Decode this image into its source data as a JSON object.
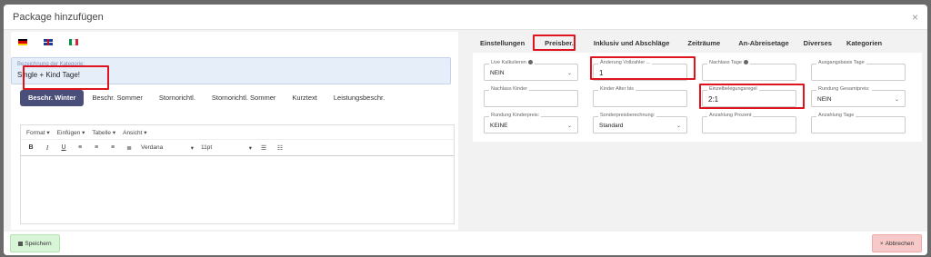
{
  "modal": {
    "title": "Package hinzufügen"
  },
  "kategorie": {
    "label": "Bezeichnung der Kategorie:",
    "value": "Single + Kind Tage!"
  },
  "desc_tabs": [
    "Beschr. Winter",
    "Beschr. Sommer",
    "Stornorichtl.",
    "Stornorichtl. Sommer",
    "Kurztext",
    "Leistungsbeschr."
  ],
  "editor": {
    "menu": [
      "Format",
      "Einfügen",
      "Tabelle",
      "Ansicht"
    ],
    "font": "Verdana",
    "size": "11pt"
  },
  "right_tabs": [
    "Einstellungen",
    "Preisber.",
    "Inklusiv und Abschläge",
    "Zeiträume",
    "An-Abreisetage",
    "Diverses",
    "Kategorien"
  ],
  "fields": {
    "live_kalk": {
      "label": "Live Kalkulieren",
      "value": "NEIN"
    },
    "anderung_vollzahler": {
      "label": "Änderung Vollzahler ...",
      "value": "1"
    },
    "nachlass_tage": {
      "label": "Nachlass Tage",
      "value": ""
    },
    "ausgangsbasis_tage": {
      "label": "Ausgangsbasis Tage",
      "value": ""
    },
    "nachlass_kinder": {
      "label": "Nachlass Kinder",
      "value": ""
    },
    "kinder_alter_bis": {
      "label": "Kinder Alter bis",
      "value": ""
    },
    "einzelbelegungsregel": {
      "label": "Einzelbelegungsregel",
      "value": "2:1"
    },
    "rundung_gesamtpreis": {
      "label": "Rundung Gesamtpreis:",
      "value": "NEIN"
    },
    "rundung_kinderpreis": {
      "label": "Rundung Kinderpreis:",
      "value": "KEINE"
    },
    "sonderpreisberechnung": {
      "label": "Sonderpreisberechnung:",
      "value": "Standard"
    },
    "anzahlung_prozent": {
      "label": "Anzahlung Prozent",
      "value": ""
    },
    "anzahlung_tage": {
      "label": "Anzahlung Tage",
      "value": ""
    }
  },
  "footer": {
    "save": "Speichern",
    "cancel": "Abbrechen"
  },
  "colors": {
    "highlight": "#e0141e",
    "active_tab": "#4a4f7a",
    "save_bg": "#d8f5d8",
    "cancel_bg": "#f8c9c9"
  }
}
